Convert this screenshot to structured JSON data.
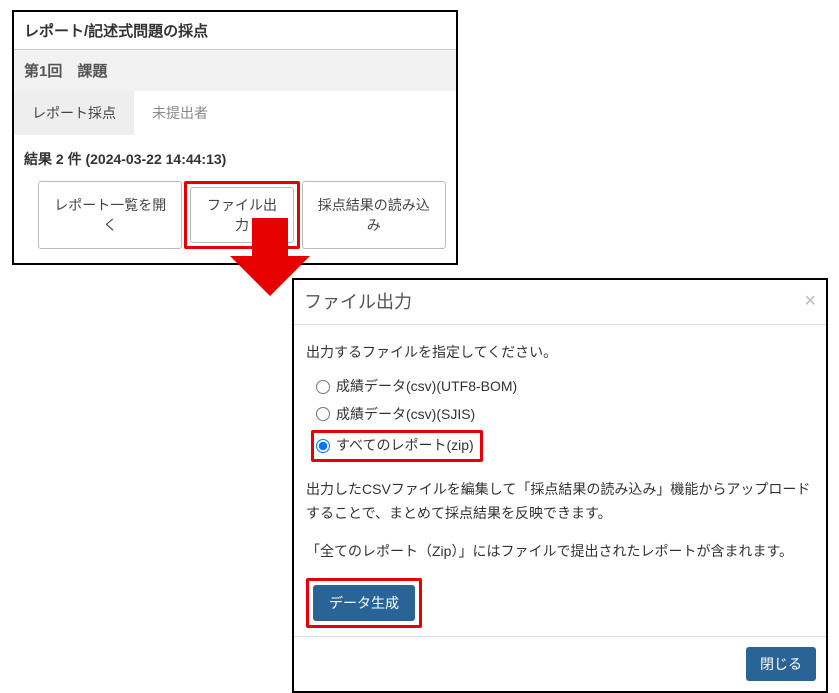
{
  "panel": {
    "title": "レポート/記述式問題の採点",
    "sub_header": "第1回　課題",
    "tabs": {
      "active": "レポート採点",
      "inactive": "未提出者"
    },
    "results_label": "結果 2 件 (2024-03-22 14:44:13)",
    "buttons": {
      "open_list": "レポート一覧を開く",
      "file_output": "ファイル出力",
      "import_results": "採点結果の読み込み"
    }
  },
  "dialog": {
    "title": "ファイル出力",
    "close_glyph": "×",
    "instruction": "出力するファイルを指定してください。",
    "options": {
      "csv_utf8": "成績データ(csv)(UTF8-BOM)",
      "csv_sjis": "成績データ(csv)(SJIS)",
      "all_zip": "すべてのレポート(zip)"
    },
    "note1": "出力したCSVファイルを編集して「採点結果の読み込み」機能からアップロードすることで、まとめて採点結果を反映できます。",
    "note2": "「全てのレポート（Zip）」にはファイルで提出されたレポートが含まれます。",
    "generate_btn": "データ生成",
    "close_btn": "閉じる"
  }
}
